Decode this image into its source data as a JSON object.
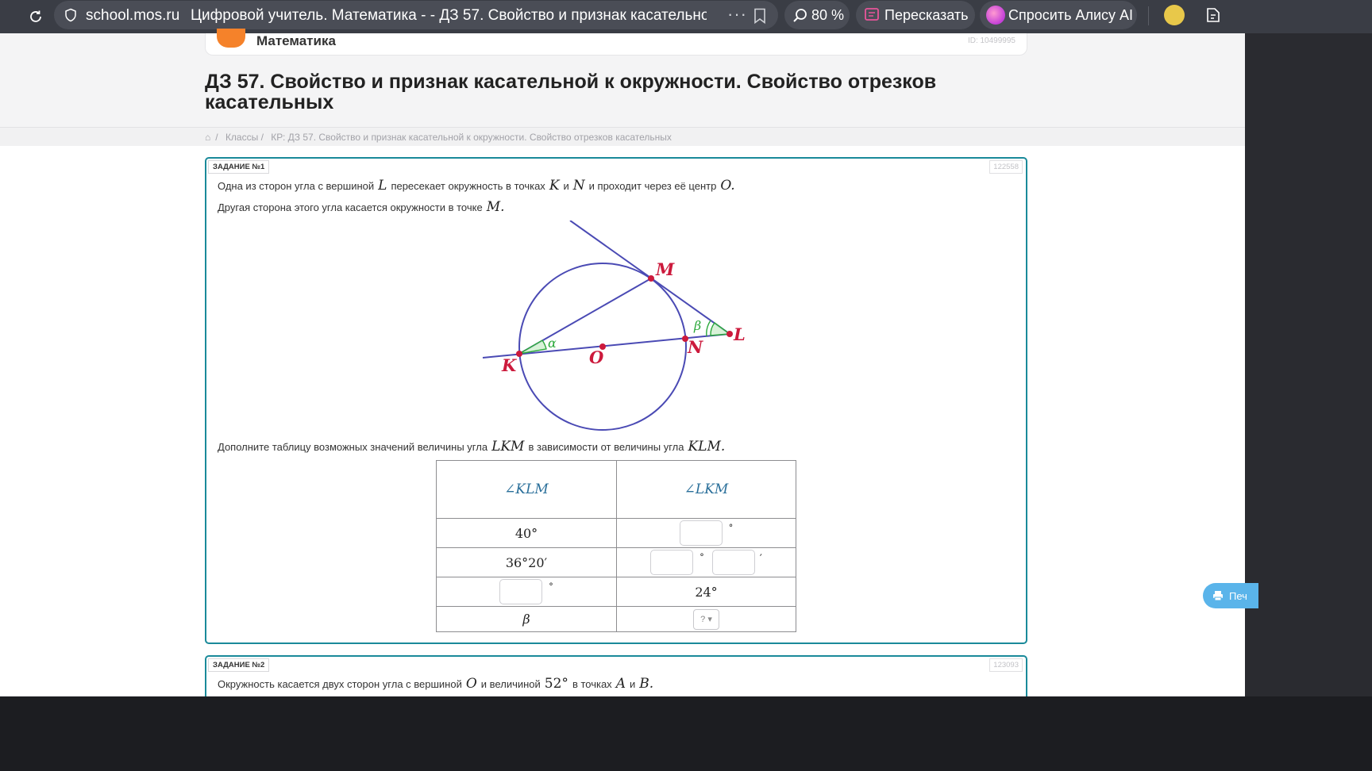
{
  "browser": {
    "domain": "school.mos.ru",
    "tab_title": "Цифровой учитель. Математика - - ДЗ 57. Свойство и признак касательной к о...",
    "more": "···",
    "zoom": "80 %",
    "retell": "Пересказать",
    "alice": "Спросить Алису AI"
  },
  "header": {
    "subject": "Математика",
    "id_label": "ID: 10499995",
    "title": "ДЗ 57. Свойство и признак касательной к окружности. Свойство отрезков касательных"
  },
  "breadcrumbs": {
    "home_sep": "/",
    "classes": "Классы /",
    "current": "КР: ДЗ 57. Свойство и признак касательной к окружности. Свойство отрезков касательных"
  },
  "print_button": "Печ",
  "task1": {
    "label": "ЗАДАНИЕ №1",
    "id": "122558",
    "line1": {
      "a": "Одна из сторон угла с вершиной",
      "L": "L",
      "b": "пересекает окружность в точках",
      "K": "K",
      "c": "и",
      "N": "N",
      "d": "и проходит через её центр",
      "O": "O."
    },
    "line2": {
      "a": "Другая сторона этого угла касается окружности в точке",
      "M": "M."
    },
    "diagram_labels": {
      "M": "M",
      "L": "L",
      "N": "N",
      "K": "K",
      "O": "O",
      "alpha": "α",
      "beta": "β"
    },
    "prompt": {
      "a": "Дополните таблицу возможных значений величины угла",
      "LKM": "LKM",
      "b": "в зависимости от величины угла",
      "KLM": "KLM."
    },
    "table": {
      "col1": "∠KLM",
      "col2": "∠LKM",
      "r1c1": "40°",
      "r2c1": "36°20′",
      "r3c2": "24°",
      "r4c1": "β",
      "deg": "°",
      "min": "′",
      "select_value": "? ▾"
    }
  },
  "task2": {
    "label": "ЗАДАНИЕ №2",
    "id": "123093",
    "line1": {
      "a": "Окружность касается двух сторон угла с вершиной",
      "O": "O",
      "b": "и величиной",
      "val": "52°",
      "c": "в точках",
      "A": "A",
      "d": "и",
      "B": "B."
    }
  },
  "colors": {
    "toolbar": "#3a3d45",
    "card_border": "#1a8a9a",
    "diagram_blue": "#4a4ab4",
    "point_red": "#cc1a3c",
    "angle_green": "#2aa83a"
  }
}
